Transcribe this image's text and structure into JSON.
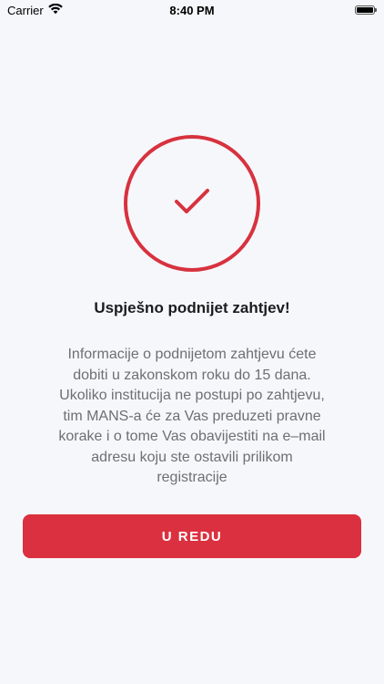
{
  "status_bar": {
    "carrier": "Carrier",
    "time": "8:40 PM",
    "battery_level": 1.0,
    "icons": [
      "wifi-icon",
      "battery-icon"
    ]
  },
  "success": {
    "icon": "checkmark-icon",
    "title": "Uspješno podnijet zahtjev!",
    "message_lines": [
      "Informacije o podnijetom zahtjevu ćete",
      "dobiti u zakonskom roku do 15 dana.",
      "Ukoliko institucija ne postupi po zahtjevu,",
      "tim MANS-a će za Vas preduzeti pravne",
      "korake i o tome Vas obavijestiti na e–mail",
      "adresu koju ste ostavili prilikom",
      "registracije"
    ]
  },
  "ok_button": {
    "label": "U REDU"
  },
  "colors": {
    "accent": "#d7323f",
    "background": "#f6f7fa",
    "title_text": "#1c1c1e",
    "body_text": "#6d6f76",
    "button_text": "#ffffff"
  }
}
